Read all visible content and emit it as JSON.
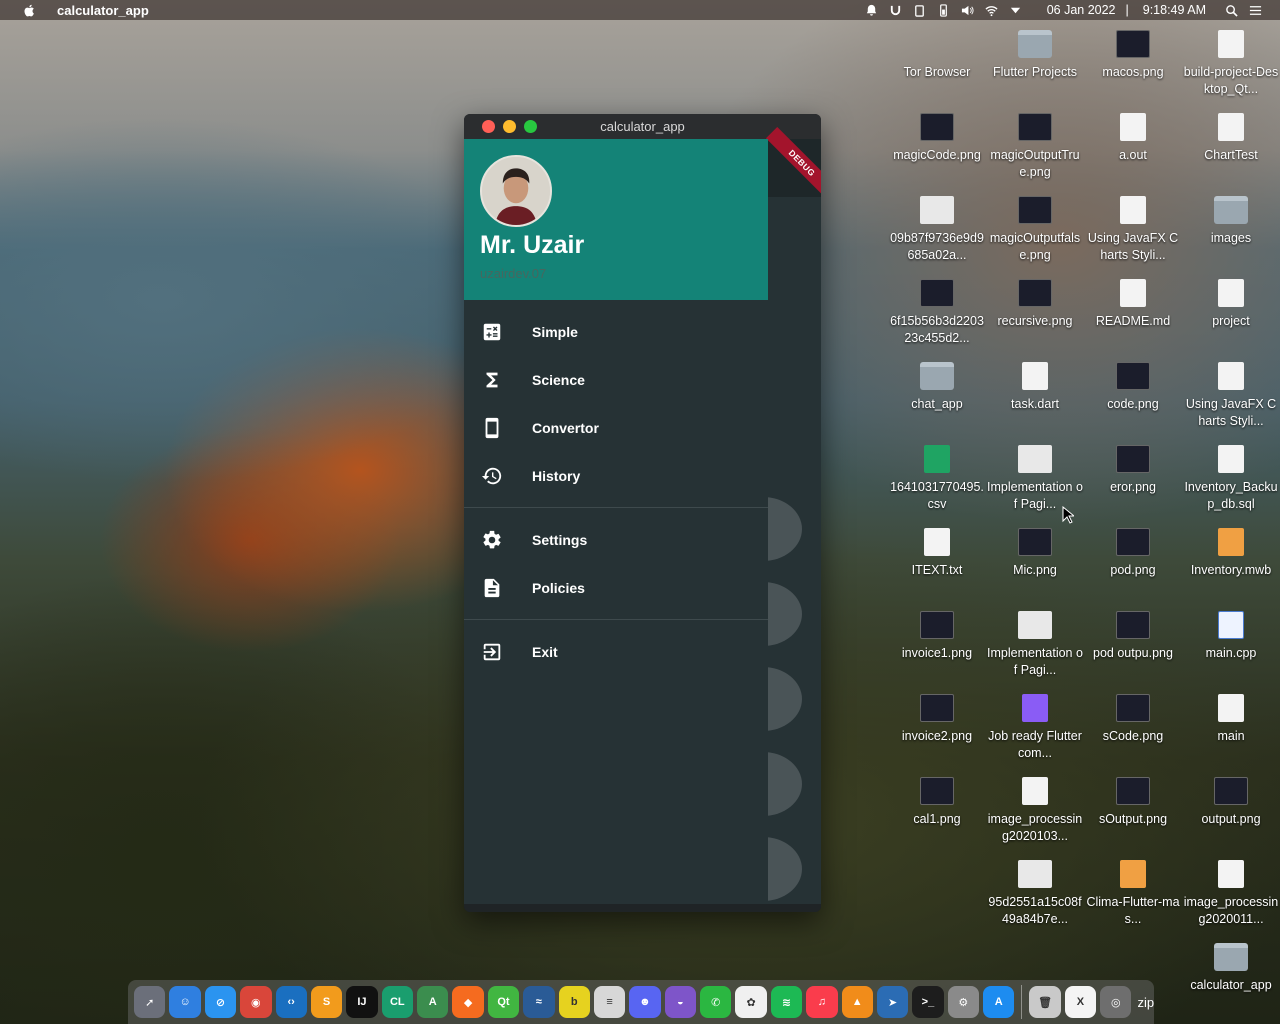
{
  "menubar": {
    "app_name": "calculator_app",
    "date": "06 Jan 2022",
    "time": "9:18:49 AM"
  },
  "window": {
    "title": "calculator_app",
    "debug_banner": "DEBUG",
    "calc_buttons": [
      "/",
      "*",
      "-",
      "+",
      "="
    ]
  },
  "drawer": {
    "user_name": "Mr. Uzair",
    "user_handle": "uzairdev.07",
    "items": [
      {
        "label": "Simple",
        "icon": "calculator-icon"
      },
      {
        "label": "Science",
        "icon": "sigma-icon"
      },
      {
        "label": "Convertor",
        "icon": "phone-icon"
      },
      {
        "label": "History",
        "icon": "history-icon"
      },
      {
        "label": "Settings",
        "icon": "gear-icon"
      },
      {
        "label": "Policies",
        "icon": "document-icon"
      },
      {
        "label": "Exit",
        "icon": "exit-icon"
      }
    ],
    "colors": {
      "header": "#148377",
      "body": "#263235"
    }
  },
  "desktop": {
    "icons": [
      {
        "label": "Tor Browser",
        "kind": "none"
      },
      {
        "label": "Flutter Projects",
        "kind": "folder"
      },
      {
        "label": "macos.png",
        "kind": "dark"
      },
      {
        "label": "build-project-Desktop_Qt...",
        "kind": "doc"
      },
      {
        "label": "magicCode.png",
        "kind": "dark"
      },
      {
        "label": "magicOutputTrue.png",
        "kind": "dark"
      },
      {
        "label": "a.out",
        "kind": "doc"
      },
      {
        "label": "ChartTest",
        "kind": "doc"
      },
      {
        "label": "09b87f9736e9d9685a02a...",
        "kind": "light"
      },
      {
        "label": "magicOutputfalse.png",
        "kind": "dark"
      },
      {
        "label": "Using JavaFX Charts Styli...",
        "kind": "doc"
      },
      {
        "label": "images",
        "kind": "folder"
      },
      {
        "label": "6f15b56b3d220323c455d2...",
        "kind": "dark"
      },
      {
        "label": "recursive.png",
        "kind": "dark"
      },
      {
        "label": "README.md",
        "kind": "doc"
      },
      {
        "label": "project",
        "kind": "doc"
      },
      {
        "label": "chat_app",
        "kind": "folder"
      },
      {
        "label": "task.dart",
        "kind": "doc"
      },
      {
        "label": "code.png",
        "kind": "dark"
      },
      {
        "label": "Using JavaFX Charts Styli...",
        "kind": "doc"
      },
      {
        "label": "1641031770495.csv",
        "kind": "sheet"
      },
      {
        "label": "Implementation of Pagi...",
        "kind": "light"
      },
      {
        "label": "eror.png",
        "kind": "dark"
      },
      {
        "label": "Inventory_Backup_db.sql",
        "kind": "doc"
      },
      {
        "label": "ITEXT.txt",
        "kind": "doc"
      },
      {
        "label": "Mic.png",
        "kind": "dark"
      },
      {
        "label": "pod.png",
        "kind": "dark"
      },
      {
        "label": "Inventory.mwb",
        "kind": "orange"
      },
      {
        "label": "invoice1.png",
        "kind": "dark"
      },
      {
        "label": "Implementation of Pagi...",
        "kind": "light"
      },
      {
        "label": "pod outpu.png",
        "kind": "dark"
      },
      {
        "label": "main.cpp",
        "kind": "blue"
      },
      {
        "label": "invoice2.png",
        "kind": "dark"
      },
      {
        "label": "Job ready Flutter com...",
        "kind": "purple"
      },
      {
        "label": "sCode.png",
        "kind": "dark"
      },
      {
        "label": "main",
        "kind": "doc"
      },
      {
        "label": "cal1.png",
        "kind": "dark"
      },
      {
        "label": "image_processing2020103...",
        "kind": "doc"
      },
      {
        "label": "sOutput.png",
        "kind": "dark"
      },
      {
        "label": "output.png",
        "kind": "dark"
      },
      {
        "label": "95d2551a15c08f49a84b7e...",
        "kind": "light"
      },
      {
        "label": "Clima-Flutter-mas...",
        "kind": "orange"
      },
      {
        "label": "image_processing2020011...",
        "kind": "doc"
      },
      {
        "label": "calculator_app",
        "kind": "folder"
      }
    ]
  },
  "dock": {
    "apps": [
      {
        "name": "launchpad-icon",
        "color": "#6b6f7a",
        "glyph": "➚"
      },
      {
        "name": "finder-icon",
        "color": "#2f7fe0",
        "glyph": "☺"
      },
      {
        "name": "safari-icon",
        "color": "#2b94f0",
        "glyph": "⊘"
      },
      {
        "name": "chrome-icon",
        "color": "#d9463a",
        "glyph": "◉"
      },
      {
        "name": "vscode-icon",
        "color": "#1a6fc0",
        "glyph": "‹›"
      },
      {
        "name": "sublime-icon",
        "color": "#f29b1c",
        "glyph": "S"
      },
      {
        "name": "intellij-icon",
        "color": "#111",
        "glyph": "IJ"
      },
      {
        "name": "clion-icon",
        "color": "#1a9e6e",
        "glyph": "CL"
      },
      {
        "name": "android-studio-icon",
        "color": "#3b8d4e",
        "glyph": "A"
      },
      {
        "name": "brave-icon",
        "color": "#f56b1f",
        "glyph": "◆"
      },
      {
        "name": "qt-icon",
        "color": "#41b641",
        "glyph": "Qt"
      },
      {
        "name": "mysql-workbench-icon",
        "color": "#2a5b96",
        "glyph": "≈"
      },
      {
        "name": "bitwarden-icon",
        "color": "#e6d21f",
        "glyph": "b"
      },
      {
        "name": "database-icon",
        "color": "#d7d7d7",
        "glyph": "≡"
      },
      {
        "name": "discord-icon",
        "color": "#5865f2",
        "glyph": "☻"
      },
      {
        "name": "github-icon",
        "color": "#7e55c9",
        "glyph": "◒"
      },
      {
        "name": "whatsapp-icon",
        "color": "#2bb741",
        "glyph": "✆"
      },
      {
        "name": "photos-icon",
        "color": "#f0f0f0",
        "glyph": "✿"
      },
      {
        "name": "spotify-icon",
        "color": "#1db954",
        "glyph": "≋"
      },
      {
        "name": "music-icon",
        "color": "#fa3c4c",
        "glyph": "♫"
      },
      {
        "name": "vlc-icon",
        "color": "#f18c1a",
        "glyph": "▲"
      },
      {
        "name": "prompt-icon",
        "color": "#2b6cb4",
        "glyph": "➤"
      },
      {
        "name": "terminal-icon",
        "color": "#1d1d1d",
        "glyph": ">_"
      },
      {
        "name": "system-preferences-icon",
        "color": "#8a8a8a",
        "glyph": "⚙"
      },
      {
        "name": "app-store-icon",
        "color": "#1d8cf0",
        "glyph": "A"
      },
      {
        "name": "trash-icon",
        "color": "#c9c9c9",
        "glyph": "🗑"
      },
      {
        "name": "xquartz-icon",
        "color": "#f4f4f4",
        "glyph": "X"
      },
      {
        "name": "screenshot-icon",
        "color": "#6e6e6e",
        "glyph": "◎"
      }
    ],
    "zip_label": "zip"
  }
}
